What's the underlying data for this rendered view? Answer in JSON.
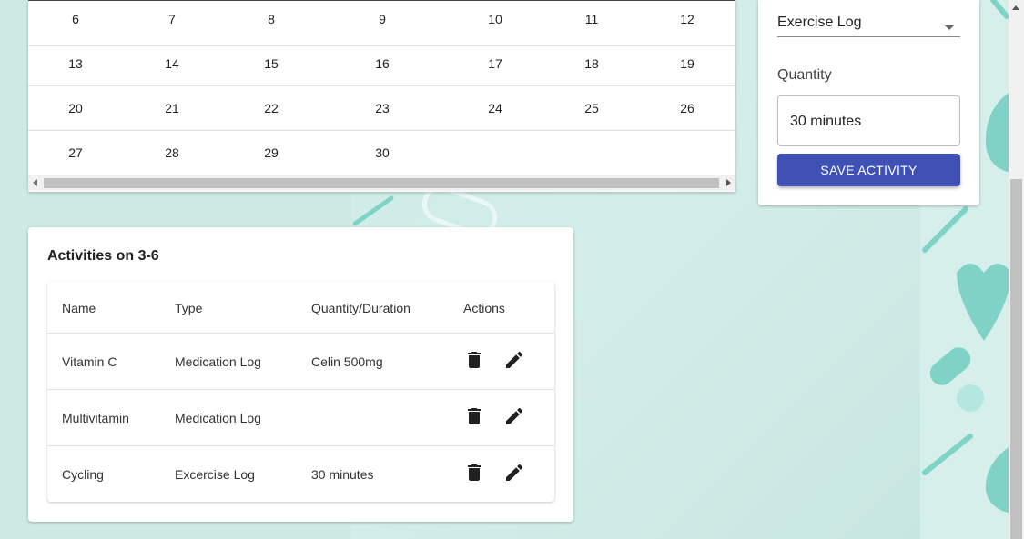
{
  "calendar": {
    "weeks": [
      [
        "6",
        "7",
        "8",
        "9",
        "10",
        "11",
        "12"
      ],
      [
        "13",
        "14",
        "15",
        "16",
        "17",
        "18",
        "19"
      ],
      [
        "20",
        "21",
        "22",
        "23",
        "24",
        "25",
        "26"
      ],
      [
        "27",
        "28",
        "29",
        "30",
        "",
        "",
        ""
      ]
    ]
  },
  "form": {
    "log_type": "Exercise Log",
    "quantity_label": "Quantity",
    "quantity_value": "30 minutes",
    "save_label": "SAVE ACTIVITY",
    "accent_color": "#3f51b5"
  },
  "activities": {
    "title": "Activities on 3-6",
    "headers": {
      "name": "Name",
      "type": "Type",
      "quantity": "Quantity/Duration",
      "actions": "Actions"
    },
    "rows": [
      {
        "name": "Vitamin C",
        "type": "Medication Log",
        "quantity": "Celin 500mg"
      },
      {
        "name": "Multivitamin",
        "type": "Medication Log",
        "quantity": ""
      },
      {
        "name": "Cycling",
        "type": "Excercise Log",
        "quantity": "30 minutes"
      }
    ],
    "row_icons": [
      "trash-icon",
      "pencil-icon"
    ]
  }
}
